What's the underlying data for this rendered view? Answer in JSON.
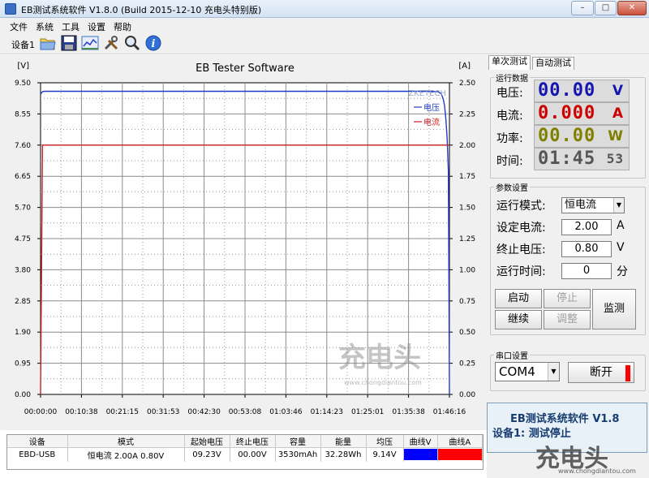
{
  "window": {
    "title": "EB测试系统软件 V1.8.0 (Build 2015-12-10 充电头特别版)",
    "minimize_glyph": "–",
    "maximize_glyph": "□",
    "close_glyph": "✕"
  },
  "menu": [
    "文件",
    "系统",
    "工具",
    "设置",
    "帮助"
  ],
  "toolbar": {
    "device_label": "设备1",
    "icons": [
      "folder-open-icon",
      "save-icon",
      "chart-icon",
      "tools-icon",
      "zoom-icon",
      "info-icon"
    ]
  },
  "chart_data": {
    "type": "line",
    "title": "EB Tester Software",
    "left_unit": "[V]",
    "right_unit": "[A]",
    "y_left_ticks": [
      "9.50",
      "8.55",
      "7.60",
      "6.65",
      "5.70",
      "4.75",
      "3.80",
      "2.85",
      "1.90",
      "0.95",
      "0.00"
    ],
    "y_right_ticks": [
      "2.50",
      "2.25",
      "2.00",
      "1.75",
      "1.50",
      "1.25",
      "1.00",
      "0.75",
      "0.50",
      "0.25",
      "0.00"
    ],
    "x_ticks": [
      "00:00:00",
      "00:10:38",
      "00:21:15",
      "00:31:53",
      "00:42:30",
      "00:53:08",
      "01:03:46",
      "01:14:23",
      "01:25:01",
      "01:35:38",
      "01:46:16"
    ],
    "ylim_left": [
      0,
      9.5
    ],
    "ylim_right": [
      0,
      2.5
    ],
    "x_range_seconds": [
      0,
      6376
    ],
    "brand_text": "ZKETECH",
    "legend_position": "top-right",
    "series": [
      {
        "name": "电压",
        "axis": "left",
        "color": "#1f3cc8",
        "x": [
          0,
          30,
          60,
          300,
          1000,
          2000,
          3000,
          4000,
          5000,
          6000,
          6200,
          6250,
          6280,
          6300,
          6320,
          6340,
          6360,
          6376
        ],
        "y": [
          9.15,
          9.23,
          9.24,
          9.24,
          9.24,
          9.24,
          9.24,
          9.24,
          9.24,
          9.24,
          9.23,
          9.16,
          9.0,
          8.8,
          8.4,
          7.8,
          6.8,
          0
        ]
      },
      {
        "name": "电流",
        "axis": "right",
        "color": "#cc2020",
        "x": [
          0,
          30,
          6376
        ],
        "y": [
          0,
          2.0,
          2.0
        ]
      }
    ],
    "grid": true
  },
  "table": {
    "headers": [
      "设备",
      "模式",
      "起始电压",
      "终止电压",
      "容量",
      "能量",
      "均压",
      "曲线V",
      "曲线A"
    ],
    "row": [
      "EBD-USB",
      "恒电流  2.00A  0.80V",
      "09.23V",
      "00.00V",
      "3530mAh",
      "32.28Wh",
      "9.14V"
    ],
    "curve_v_color": "#0000ff",
    "curve_a_color": "#ff0000"
  },
  "tabs": [
    "单次测试",
    "自动测试"
  ],
  "run_data": {
    "legend": "运行数据",
    "voltage_label": "电压:",
    "voltage_value": "00.00",
    "voltage_unit": "V",
    "voltage_color": "#1515b0",
    "current_label": "电流:",
    "current_value": "0.000",
    "current_unit": "A",
    "current_color": "#cc0000",
    "power_label": "功率:",
    "power_value": "00.00",
    "power_unit": "W",
    "power_color": "#808000",
    "time_label": "时间:",
    "time_value": "01:45",
    "time_seconds": "53",
    "time_color": "#555555"
  },
  "params": {
    "legend": "参数设置",
    "mode_label": "运行模式:",
    "mode_value": "恒电流",
    "current_label": "设定电流:",
    "current_value": "2.00",
    "current_unit": "A",
    "voltage_label": "终止电压:",
    "voltage_value": "0.80",
    "voltage_unit": "V",
    "time_label": "运行时间:",
    "time_value": "0",
    "time_unit": "分",
    "start_label": "启动",
    "stop_label": "停止",
    "continue_label": "继续",
    "adjust_label": "调整",
    "monitor_label": "监测"
  },
  "serial": {
    "legend": "串口设置",
    "port": "COM4",
    "disconnect_label": "断开"
  },
  "status": {
    "line1": "EB测试系统软件 V1.8",
    "line2": "设备1: 测试停止"
  },
  "watermarks": {
    "chart_logo": "充电头",
    "chart_url": "www.chongdiantou.com",
    "corner_logo": "充电头",
    "corner_url": "www.chongdiantou.com"
  }
}
